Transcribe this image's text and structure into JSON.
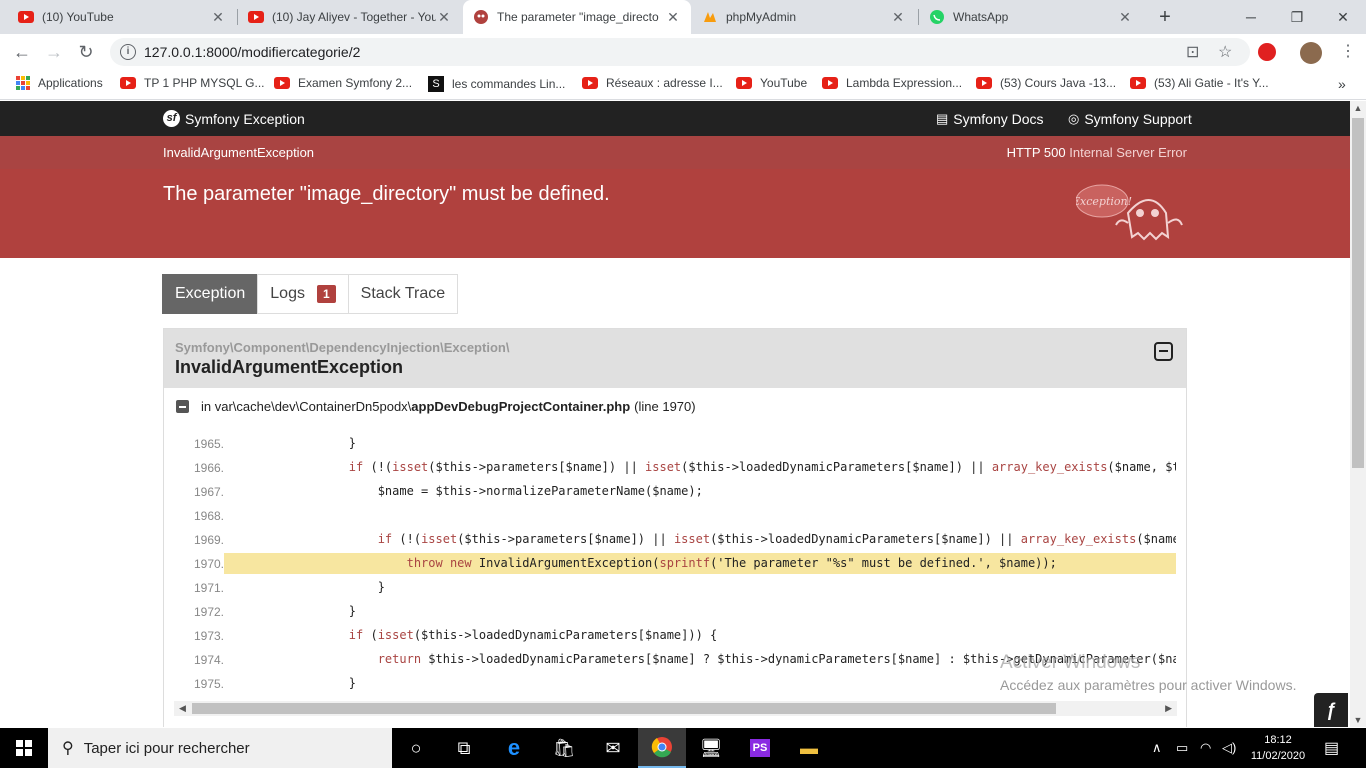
{
  "browser": {
    "tabs": [
      {
        "title": "(10) YouTube",
        "icon": "youtube-icon",
        "active": false
      },
      {
        "title": "(10) Jay Aliyev - Together - You",
        "icon": "youtube-icon",
        "active": false
      },
      {
        "title": "The parameter \"image_directo",
        "icon": "symfony-ghost-icon",
        "active": true
      },
      {
        "title": "phpMyAdmin",
        "icon": "phpmyadmin-icon",
        "active": false
      },
      {
        "title": "WhatsApp",
        "icon": "whatsapp-icon",
        "active": false
      }
    ],
    "url": "127.0.0.1:8000/modifiercategorie/2",
    "bookmarks": [
      {
        "label": "Applications",
        "icon": "apps-grid-icon"
      },
      {
        "label": "TP 1 PHP MYSQL G...",
        "icon": "youtube-icon"
      },
      {
        "label": "Examen Symfony 2...",
        "icon": "youtube-icon"
      },
      {
        "label": "les commandes Lin...",
        "icon": "sourceforge-icon"
      },
      {
        "label": "Réseaux : adresse I...",
        "icon": "youtube-icon"
      },
      {
        "label": "YouTube",
        "icon": "youtube-icon"
      },
      {
        "label": "Lambda Expression...",
        "icon": "youtube-icon"
      },
      {
        "label": "(53) Cours Java -13...",
        "icon": "youtube-icon"
      },
      {
        "label": "(53) Ali Gatie - It's Y...",
        "icon": "youtube-icon"
      }
    ]
  },
  "symfony": {
    "brand": "Symfony Exception",
    "docs_link": "Symfony Docs",
    "support_link": "Symfony Support",
    "exception_short": "InvalidArgumentException",
    "http_code": "HTTP 500",
    "http_text": "Internal Server Error",
    "message": "The parameter \"image_directory\" must be defined.",
    "ghost_text": "Exception!",
    "tabs": {
      "exception": "Exception",
      "logs": "Logs",
      "logs_count": "1",
      "stack_trace": "Stack Trace"
    },
    "trace": {
      "namespace": "Symfony\\Component\\DependencyInjection\\Exception\\",
      "class": "InvalidArgumentException",
      "file_prefix": "in var\\cache\\dev\\ContainerDn5podx\\",
      "file_name": "appDevDebugProjectContainer.php",
      "file_line": "(line 1970)"
    },
    "code_lines": [
      {
        "n": "1965.",
        "code": "        }"
      },
      {
        "n": "1966.",
        "code": "        if (!(isset($this->parameters[$name]) || isset($this->loadedDynamicParameters[$name]) || array_key_exists($name, $this->para"
      },
      {
        "n": "1967.",
        "code": "            $name = $this->normalizeParameterName($name);"
      },
      {
        "n": "1968.",
        "code": ""
      },
      {
        "n": "1969.",
        "code": "            if (!(isset($this->parameters[$name]) || isset($this->loadedDynamicParameters[$name]) || array_key_exists($name, $this->"
      },
      {
        "n": "1970.",
        "code": "                throw new InvalidArgumentException(sprintf('The parameter \"%s\" must be defined.', $name));",
        "highlight": true
      },
      {
        "n": "1971.",
        "code": "            }"
      },
      {
        "n": "1972.",
        "code": "        }"
      },
      {
        "n": "1973.",
        "code": "        if (isset($this->loadedDynamicParameters[$name])) {"
      },
      {
        "n": "1974.",
        "code": "            return $this->loadedDynamicParameters[$name] ? $this->dynamicParameters[$name] : $this->getDynamicParameter($name);"
      },
      {
        "n": "1975.",
        "code": "        }"
      }
    ]
  },
  "watermark": {
    "line1": "Activer Windows",
    "line2": "Accédez aux paramètres pour activer Windows."
  },
  "taskbar": {
    "search_placeholder": "Taper ici pour rechercher",
    "time": "18:12",
    "date": "11/02/2020"
  },
  "colors": {
    "symfony_red": "#b0413e",
    "status_red": "#a94442",
    "highlight": "#f7e6a0"
  }
}
